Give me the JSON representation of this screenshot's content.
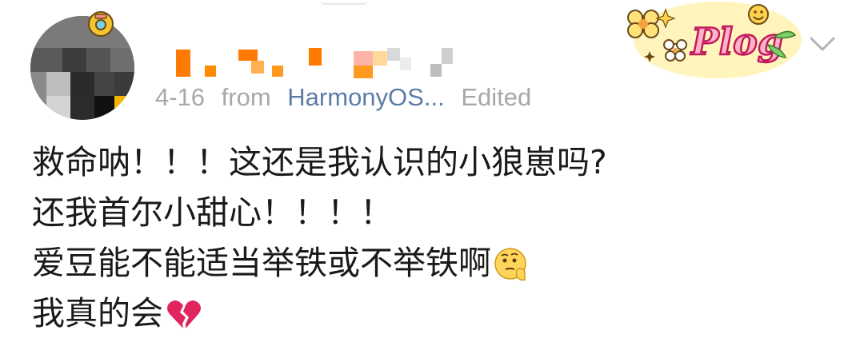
{
  "post": {
    "date": "4-16",
    "source_prefix": "from",
    "source": "HarmonyOS...",
    "edited_label": "Edited",
    "sticker_text": "Plog",
    "lines": [
      "救命呐！！！这还是我认识的小狼崽吗?",
      "还我首尔小甜心！！！！",
      "爱豆能不能适当举铁或不举铁啊",
      "我真的会"
    ],
    "line_emojis": [
      "",
      "",
      "thinking-face-emoji",
      "broken-heart-emoji"
    ]
  },
  "colors": {
    "meta_gray": "#a8a8a8",
    "source_blue": "#5c7da8",
    "text": "#1a1a1a",
    "mosaic_orange": "#ff8a00",
    "broken_heart": "#e0245e"
  },
  "icons": {
    "avatar_badge": "camera-sticker-icon",
    "more": "chevron-down-icon"
  }
}
